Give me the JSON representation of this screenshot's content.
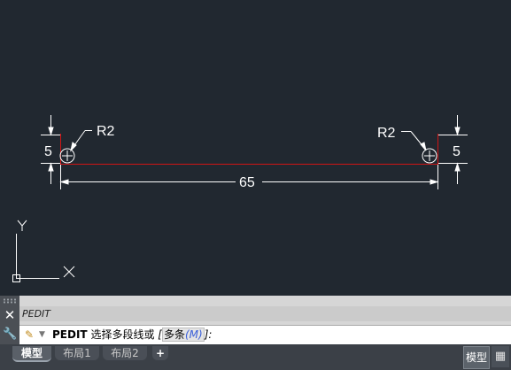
{
  "drawing": {
    "left_radius_label": "R2",
    "right_radius_label": "R2",
    "left_height_label": "5",
    "right_height_label": "5",
    "length_label": "65",
    "ucs_y_label": "Y",
    "ucs_x_label": "X"
  },
  "command": {
    "history_text": "PEDIT",
    "command_name": "PEDIT",
    "prompt_text": "选择多段线或",
    "open_bracket": "[",
    "option_label": "多条",
    "option_key_open": "(",
    "option_key": "M",
    "option_key_close": ")",
    "close_bracket": "]:"
  },
  "tabs": {
    "model": "模型",
    "layout1": "布局1",
    "layout2": "布局2",
    "add": "+"
  },
  "status": {
    "model_label": "模型",
    "grid_icon": "grid-icon"
  },
  "icons": [
    "close-icon",
    "wrench-icon",
    "pencil-icon",
    "caret-down-icon",
    "grid-icon"
  ],
  "colors": {
    "canvas_bg": "#212830",
    "part_line": "#d01515",
    "dimension": "#ffffff"
  }
}
